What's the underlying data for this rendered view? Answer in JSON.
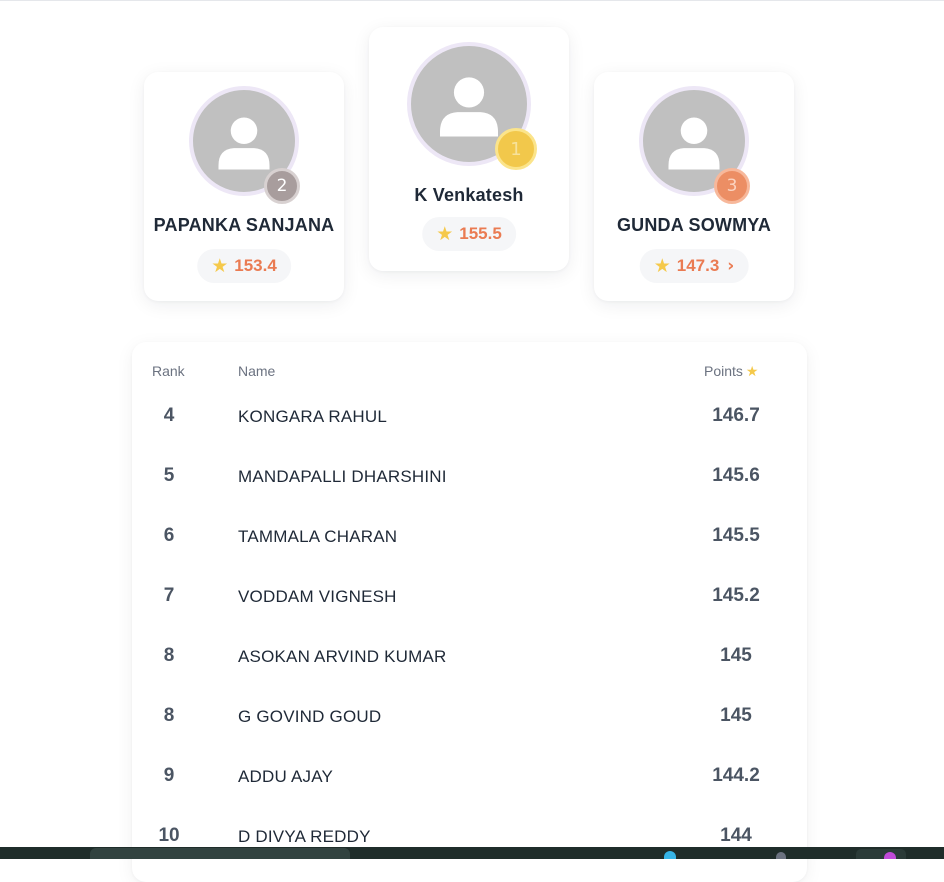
{
  "podium": {
    "second": {
      "name": "PAPANKA SANJANA",
      "rank": "2",
      "points": "153.4"
    },
    "first": {
      "name": "K Venkatesh",
      "rank": "1",
      "points": "155.5"
    },
    "third": {
      "name": "GUNDA SOWMYA",
      "rank": "3",
      "points": "147.3"
    }
  },
  "table": {
    "headers": {
      "rank": "Rank",
      "name": "Name",
      "points": "Points"
    },
    "rows": [
      {
        "rank": "4",
        "name": "KONGARA RAHUL",
        "points": "146.7"
      },
      {
        "rank": "5",
        "name": "MANDAPALLI DHARSHINI",
        "points": "145.6"
      },
      {
        "rank": "6",
        "name": "TAMMALA CHARAN",
        "points": "145.5"
      },
      {
        "rank": "7",
        "name": "VODDAM VIGNESH",
        "points": "145.2"
      },
      {
        "rank": "8",
        "name": "ASOKAN ARVIND KUMAR",
        "points": "145"
      },
      {
        "rank": "8",
        "name": "G GOVIND GOUD",
        "points": "145"
      },
      {
        "rank": "9",
        "name": "ADDU AJAY",
        "points": "144.2"
      },
      {
        "rank": "10",
        "name": "D DIVYA REDDY",
        "points": "144"
      }
    ]
  },
  "icons": {
    "star": "star-icon",
    "chevron": "chevron-right-icon",
    "avatar": "user-placeholder-icon"
  },
  "colors": {
    "points_accent": "#ea7b52",
    "star": "#f5c94b",
    "gold_medal": "#f2c84b",
    "silver_medal": "#a89d9d",
    "bronze_medal": "#ec8e64",
    "avatar_ring": "#ede7f6"
  }
}
